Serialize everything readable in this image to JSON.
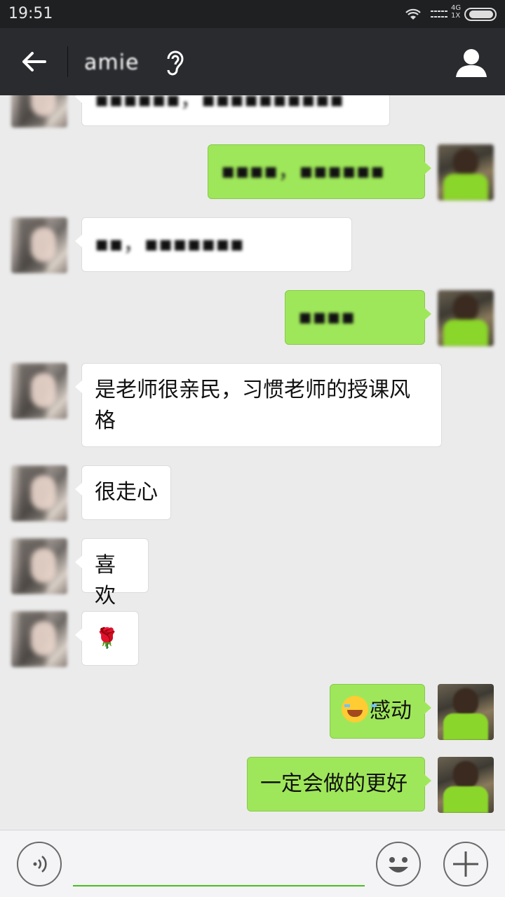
{
  "status_bar": {
    "time": "19:51",
    "network_type": "4G",
    "sim_label": "1X",
    "icons": [
      "wifi-icon",
      "signal-icon",
      "battery-icon"
    ]
  },
  "header": {
    "back_icon": "back-arrow-icon",
    "contact_name": "amie",
    "ear_icon": "earpiece-icon",
    "profile_icon": "person-icon"
  },
  "messages": [
    {
      "side": "in",
      "text": "▪▪▪▪▪▪，▪▪▪▪▪▪▪▪▪▪",
      "blurred": true
    },
    {
      "side": "out",
      "text": "▪▪▪▪，▪▪▪▪▪▪",
      "blurred": true
    },
    {
      "side": "in",
      "text": "▪▪，▪▪▪▪▪▪▪",
      "blurred": true
    },
    {
      "side": "out",
      "text": "▪▪▪▪",
      "blurred": true
    },
    {
      "side": "in",
      "text": "是老师很亲民，习惯老师的授课风格"
    },
    {
      "side": "in",
      "text": "很走心"
    },
    {
      "side": "in",
      "text": "喜欢"
    },
    {
      "side": "in",
      "text": "🌹",
      "emoji": "rose"
    },
    {
      "side": "out",
      "text": "感动",
      "emoji": "laughing-tears"
    },
    {
      "side": "out",
      "text": "一定会做的更好"
    }
  ],
  "input_bar": {
    "voice_icon": "voice-icon",
    "input_value": "",
    "emoji_icon": "smiley-icon",
    "plus_icon": "plus-icon",
    "accent_color": "#45c01a"
  },
  "colors": {
    "header_bg": "#2a2b2f",
    "chat_bg": "#ebebeb",
    "out_bubble": "#9fe75a",
    "in_bubble": "#ffffff"
  }
}
